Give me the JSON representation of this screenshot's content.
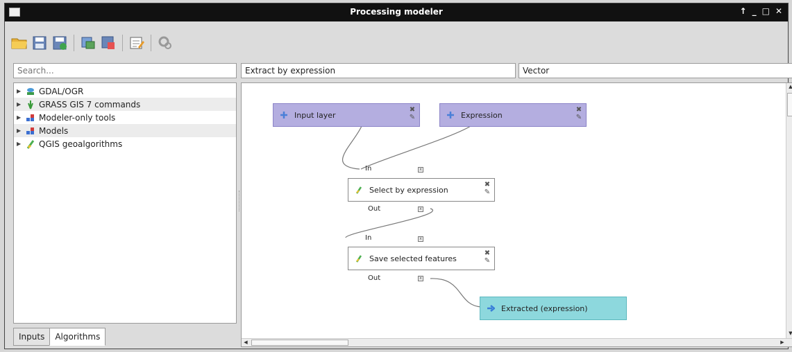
{
  "window": {
    "title": "Processing modeler",
    "controls": [
      "↑",
      "_",
      "□",
      "✕"
    ]
  },
  "toolbar": {
    "buttons": [
      "open-icon",
      "save-icon",
      "save-as-icon",
      "export-image-icon",
      "export-python-icon",
      "edit-help-icon",
      "run-model-icon"
    ]
  },
  "left_panel": {
    "search_placeholder": "Search...",
    "tree": [
      {
        "label": "GDAL/OGR",
        "icon": "gdal-icon"
      },
      {
        "label": "GRASS GIS 7 commands",
        "icon": "grass-icon"
      },
      {
        "label": "Modeler-only tools",
        "icon": "modeler-icon"
      },
      {
        "label": "Models",
        "icon": "models-icon"
      },
      {
        "label": "QGIS geoalgorithms",
        "icon": "qgis-icon"
      }
    ],
    "tabs": [
      "Inputs",
      "Algorithms"
    ]
  },
  "model": {
    "name": "Extract by expression",
    "group": "Vector"
  },
  "canvas": {
    "inputs": [
      {
        "label": "Input layer"
      },
      {
        "label": "Expression"
      }
    ],
    "algorithms": [
      {
        "label": "Select by expression",
        "port_in": "In",
        "port_out": "Out"
      },
      {
        "label": "Save selected features",
        "port_in": "In",
        "port_out": "Out"
      }
    ],
    "output": {
      "label": "Extracted (expression)"
    }
  },
  "colors": {
    "input_node": "#b4aee0",
    "output_node": "#8dd8dd",
    "titlebar": "#111111"
  }
}
